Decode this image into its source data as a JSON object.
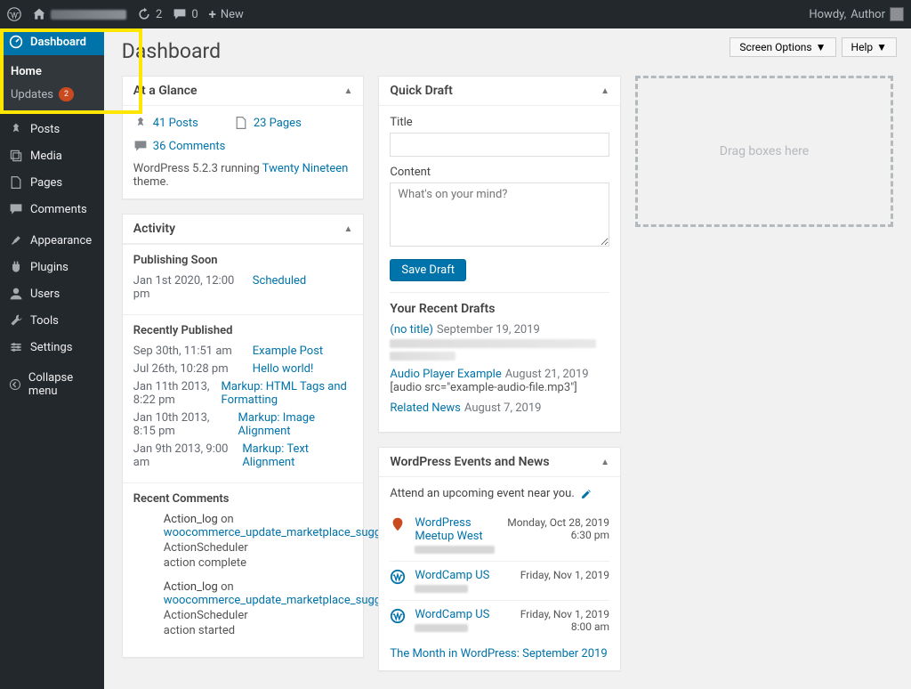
{
  "adminbar": {
    "comments_count": "0",
    "updates_count": "2",
    "new_label": "New",
    "howdy": "Howdy, ",
    "username": "Author"
  },
  "sidebar": {
    "dashboard": "Dashboard",
    "home": "Home",
    "updates": "Updates",
    "updates_count": "2",
    "posts": "Posts",
    "media": "Media",
    "pages": "Pages",
    "comments": "Comments",
    "appearance": "Appearance",
    "plugins": "Plugins",
    "users": "Users",
    "tools": "Tools",
    "settings": "Settings",
    "collapse": "Collapse menu"
  },
  "screen_options": "Screen Options",
  "help": "Help",
  "page_title": "Dashboard",
  "glance": {
    "title": "At a Glance",
    "posts": "41 Posts",
    "pages": "23 Pages",
    "comments": "36 Comments",
    "version_prefix": "WordPress 5.2.3 running ",
    "theme": "Twenty Nineteen",
    "version_suffix": " theme."
  },
  "activity": {
    "title": "Activity",
    "publishing_soon": "Publishing Soon",
    "scheduled": [
      {
        "date": "Jan 1st 2020, 12:00 pm",
        "title": "Scheduled"
      }
    ],
    "recently_published": "Recently Published",
    "published": [
      {
        "date": "Sep 30th, 11:51 am",
        "title": "Example Post"
      },
      {
        "date": "Jul 26th, 10:28 pm",
        "title": "Hello world!"
      },
      {
        "date": "Jan 11th 2013, 8:22 pm",
        "title": "Markup: HTML Tags and Formatting"
      },
      {
        "date": "Jan 10th 2013, 8:15 pm",
        "title": "Markup: Image Alignment"
      },
      {
        "date": "Jan 9th 2013, 9:00 am",
        "title": "Markup: Text Alignment"
      }
    ],
    "recent_comments": "Recent Comments",
    "comments": [
      {
        "author": "Action_log",
        "on": " on ",
        "link": "woocommerce_update_marketplace_suggestions",
        "meta": "ActionScheduler",
        "excerpt": "action complete"
      },
      {
        "author": "Action_log",
        "on": " on ",
        "link": "woocommerce_update_marketplace_suggestions",
        "meta": "ActionScheduler",
        "excerpt": "action started"
      }
    ]
  },
  "quick_draft": {
    "title": "Quick Draft",
    "title_label": "Title",
    "content_label": "Content",
    "placeholder": "What's on your mind?",
    "save": "Save Draft",
    "recent_heading": "Your Recent Drafts",
    "drafts": [
      {
        "title": "(no title)",
        "date": "September 19, 2019"
      },
      {
        "title": "Audio Player Example",
        "date": "August 21, 2019",
        "excerpt": "[audio src=\"example-audio-file.mp3\"]"
      },
      {
        "title": "Related News",
        "date": "August 7, 2019"
      }
    ]
  },
  "events": {
    "title": "WordPress Events and News",
    "intro": "Attend an upcoming event near you.",
    "list": [
      {
        "type": "meetup",
        "name": "WordPress Meetup West",
        "date": "Monday, Oct 28, 2019",
        "time": "6:30 pm"
      },
      {
        "type": "wordcamp",
        "name": "WordCamp US",
        "date": "Friday, Nov 1, 2019",
        "time": ""
      },
      {
        "type": "wordcamp",
        "name": "WordCamp US",
        "date": "Friday, Nov 1, 2019",
        "time": "8:00 am"
      }
    ],
    "news_link": "The Month in WordPress: September 2019"
  },
  "dropzone": "Drag boxes here"
}
